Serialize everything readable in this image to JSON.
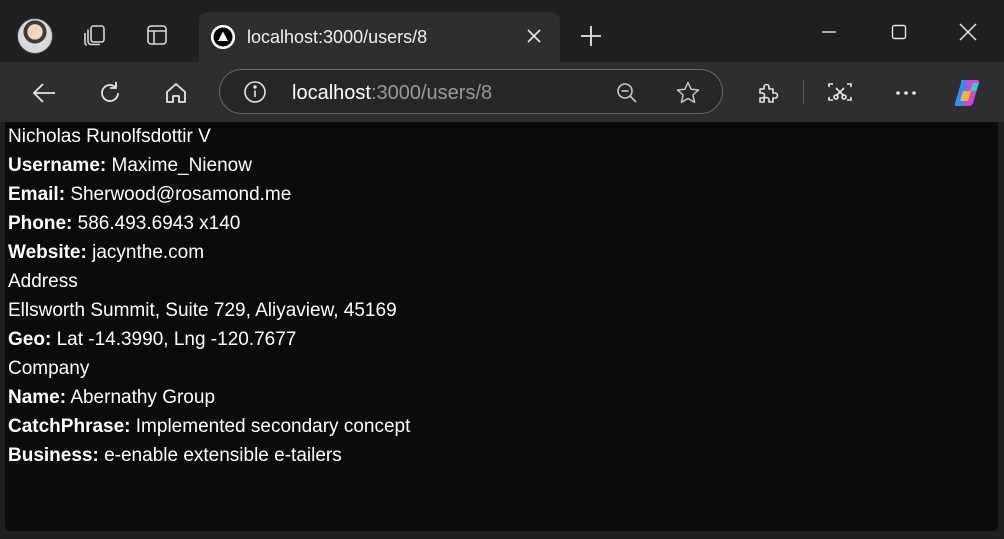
{
  "browser": {
    "tab": {
      "title": "localhost:3000/users/8"
    },
    "address_bar": {
      "host": "localhost",
      "path": ":3000/users/8"
    },
    "icons": {
      "profile": "profile-avatar",
      "workspaces": "workspaces-icon",
      "tab_actions": "vertical-tabs-icon",
      "favicon": "triangle-favicon-icon",
      "close": "close-icon",
      "new_tab": "plus-icon",
      "minimize": "minimize-icon",
      "maximize": "maximize-icon",
      "window_close": "window-close-icon",
      "back": "back-arrow-icon",
      "refresh": "refresh-icon",
      "home": "home-icon",
      "info": "info-icon",
      "zoom": "zoom-out-icon",
      "favorite": "star-icon",
      "extensions": "puzzle-icon",
      "screenshot": "screenshot-icon",
      "more": "more-icon",
      "copilot": "copilot-icon"
    }
  },
  "user": {
    "name": "Nicholas Runolfsdottir V",
    "username_label": "Username:",
    "username": "Maxime_Nienow",
    "email_label": "Email:",
    "email": "Sherwood@rosamond.me",
    "phone_label": "Phone:",
    "phone": "586.493.6943 x140",
    "website_label": "Website:",
    "website": "jacynthe.com",
    "address_heading": "Address",
    "address": "Ellsworth Summit, Suite 729, Aliyaview, 45169",
    "geo_label": "Geo:",
    "geo": "Lat -14.3990, Lng -120.7677",
    "company_heading": "Company",
    "company_name_label": "Name:",
    "company_name": "Abernathy Group",
    "catchphrase_label": "CatchPhrase:",
    "catchphrase": "Implemented secondary concept",
    "business_label": "Business:",
    "business": "e-enable extensible e-tailers"
  },
  "colors": {
    "page_background": "#0b0b0c",
    "text": "#ffffff",
    "chrome": "#202020",
    "toolbar": "#2e2e2e"
  }
}
